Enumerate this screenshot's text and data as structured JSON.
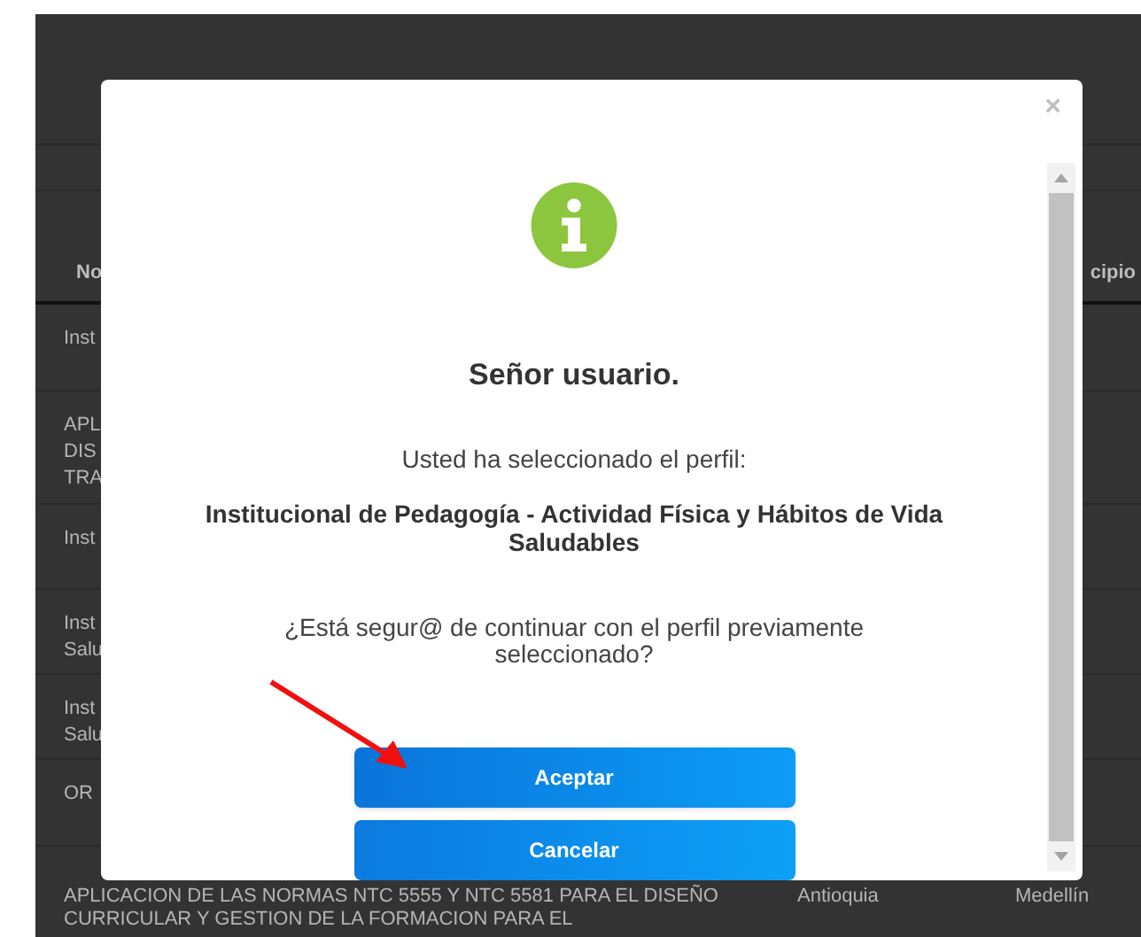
{
  "table": {
    "columns": [
      "No",
      "cipio"
    ],
    "rows": [
      {
        "column_1": [
          "Inst"
        ]
      },
      {
        "column_1": [
          "APL",
          "DIS",
          "TRA"
        ]
      },
      {
        "column_1": [
          "Inst"
        ]
      },
      {
        "column_1": [
          "Inst",
          "Salu"
        ]
      },
      {
        "column_1": [
          "Inst",
          "Salu"
        ]
      },
      {
        "column_1": [
          "OR"
        ]
      }
    ],
    "last_row": {
      "name": "APLICACION DE LAS NORMAS NTC 5555 Y NTC 5581 PARA EL DISEÑO CURRICULAR Y GESTION DE LA FORMACION PARA EL",
      "department": "Antioquia",
      "municipality": "Medellín"
    }
  },
  "dialog": {
    "close": "×",
    "title": "Señor usuario.",
    "message": "Usted ha seleccionado el perfil:",
    "profile": "Institucional de Pedagogía - Actividad Física y Hábitos de Vida Saludables",
    "question": "¿Está segur@ de continuar con el perfil previamente seleccionado?",
    "buttons": [
      {
        "label": "Aceptar",
        "kind": "primary"
      },
      {
        "label": "Cancelar",
        "kind": "secondary"
      }
    ]
  }
}
